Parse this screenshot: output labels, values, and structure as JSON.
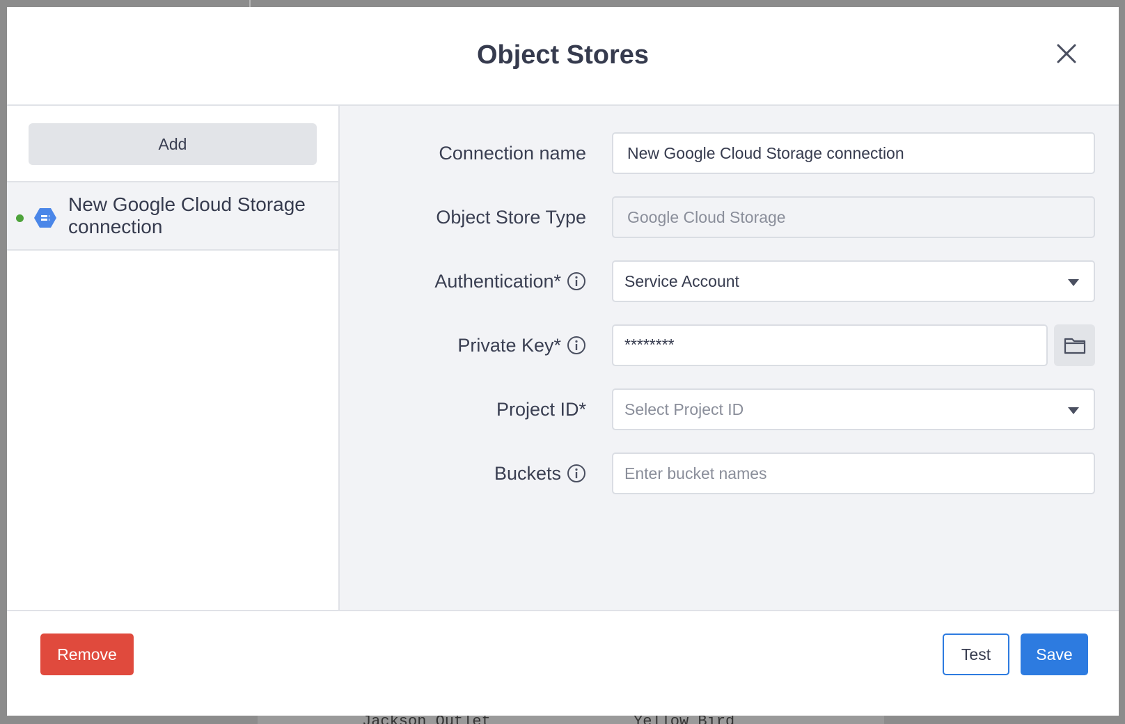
{
  "backdrop": {
    "row_text_1": "Jackson Outlet",
    "row_text_2": "Yellow Bird"
  },
  "dialog": {
    "title": "Object Stores",
    "close_icon": "close-icon"
  },
  "sidebar": {
    "add_label": "Add",
    "items": [
      {
        "label": "New Google Cloud Storage connection",
        "status": "connected",
        "status_color": "#4ea33b",
        "icon": "gcs-icon",
        "icon_color": "#4a86e8"
      }
    ]
  },
  "form": {
    "connection_name": {
      "label": "Connection name",
      "value": "New Google Cloud Storage connection"
    },
    "object_store_type": {
      "label": "Object Store Type",
      "value": "Google Cloud Storage"
    },
    "authentication": {
      "label": "Authentication*",
      "value": "Service Account"
    },
    "private_key": {
      "label": "Private Key*",
      "value": "********",
      "browse_icon": "folder-icon"
    },
    "project_id": {
      "label": "Project ID*",
      "placeholder": "Select Project ID"
    },
    "buckets": {
      "label": "Buckets",
      "placeholder": "Enter bucket names"
    }
  },
  "footer": {
    "remove_label": "Remove",
    "test_label": "Test",
    "save_label": "Save"
  },
  "colors": {
    "accent": "#2d7be0",
    "danger": "#e04a3d",
    "panel_bg": "#f2f3f6"
  }
}
